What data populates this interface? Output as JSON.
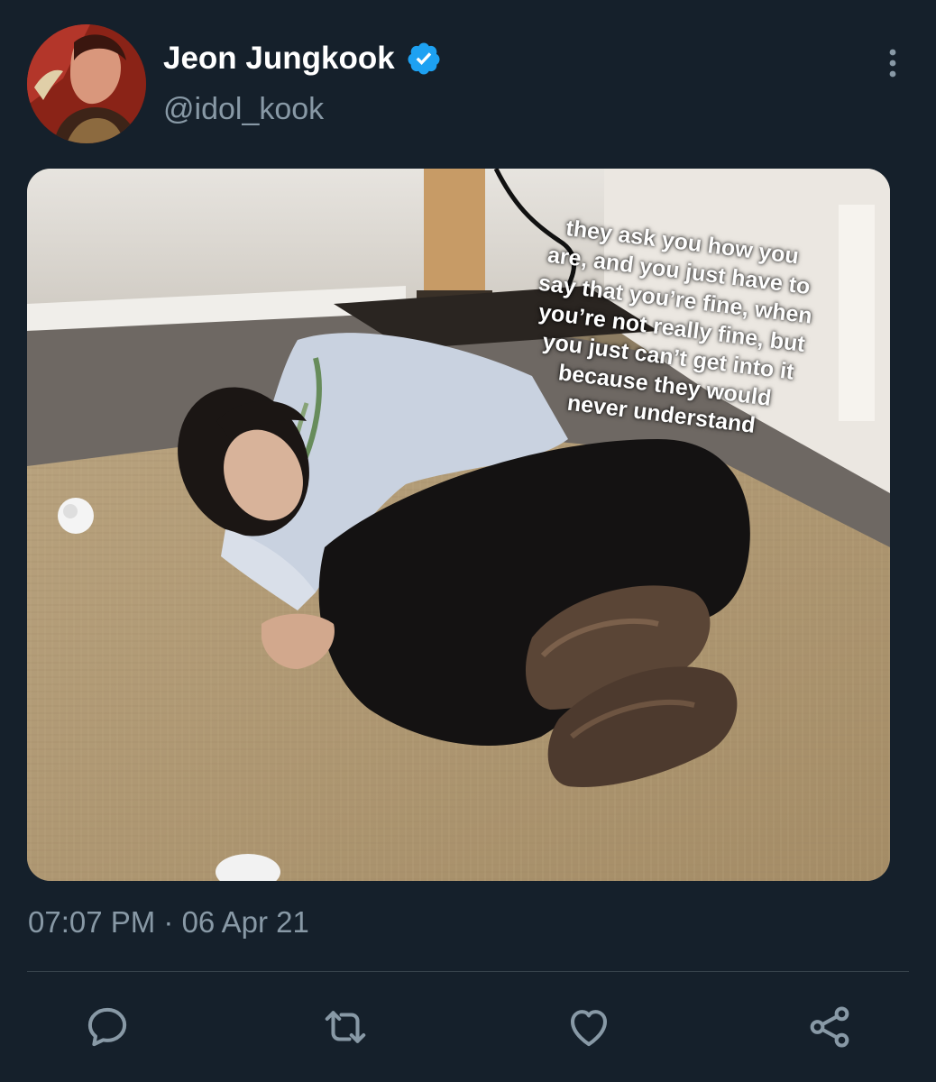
{
  "tweet": {
    "author": {
      "display_name": "Jeon Jungkook",
      "handle": "@idol_kook",
      "verified": true
    },
    "media": {
      "caption": "they ask you how you\nare, and you just have to\nsay that you’re fine, when\nyou’re not really fine, but\nyou just can’t get into it\nbecause they would\nnever understand"
    },
    "timestamp": "07:07 PM · 06 Apr 21",
    "actions": {
      "reply_icon": "reply-icon",
      "retweet_icon": "retweet-icon",
      "like_icon": "like-icon",
      "share_icon": "share-icon"
    }
  },
  "colors": {
    "background": "#15202b",
    "primary_text": "#ffffff",
    "secondary_text": "#8899a6",
    "verified_blue": "#1da1f2",
    "divider": "#38444d"
  }
}
